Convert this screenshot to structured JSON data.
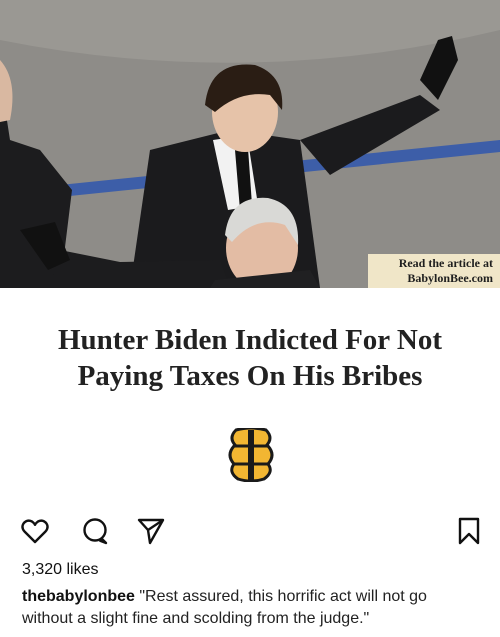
{
  "post": {
    "image_banner": {
      "line1": "Read the article at",
      "line2": "BabylonBee.com"
    },
    "headline_line1": "Hunter Biden Indicted For Not",
    "headline_line2": "Paying Taxes On His Bribes",
    "logo_icon": "babylon-bee-logo-icon"
  },
  "actions": {
    "like_icon": "heart-icon",
    "comment_icon": "comment-icon",
    "share_icon": "send-icon",
    "save_icon": "bookmark-icon"
  },
  "likes_text": "3,320 likes",
  "caption": {
    "username": "thebabylonbee",
    "text": "\"Rest assured, this horrific act will not go without a slight fine and scolding from the judge.\""
  },
  "colors": {
    "banner_bg": "#f0e6c8",
    "logo_yellow": "#f2b632",
    "text": "#222222"
  }
}
